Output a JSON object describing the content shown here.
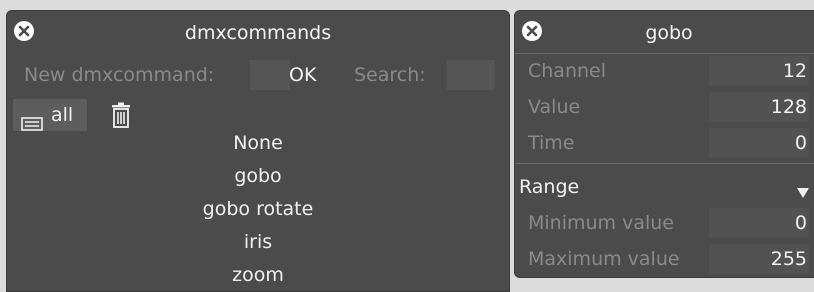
{
  "left_panel": {
    "title": "dmxcommands",
    "new_label": "New dmxcommand:",
    "ok_label": "OK",
    "search_label": "Search:",
    "filter_label": "all",
    "items": [
      "None",
      "gobo",
      "gobo rotate",
      "iris",
      "zoom"
    ]
  },
  "right_panel": {
    "title": "gobo",
    "channel_label": "Channel",
    "channel_value": "12",
    "value_label": "Value",
    "value_value": "128",
    "time_label": "Time",
    "time_value": "0",
    "range_label": "Range",
    "min_label": "Minimum value",
    "min_value": "0",
    "max_label": "Maximum value",
    "max_value": "255"
  }
}
